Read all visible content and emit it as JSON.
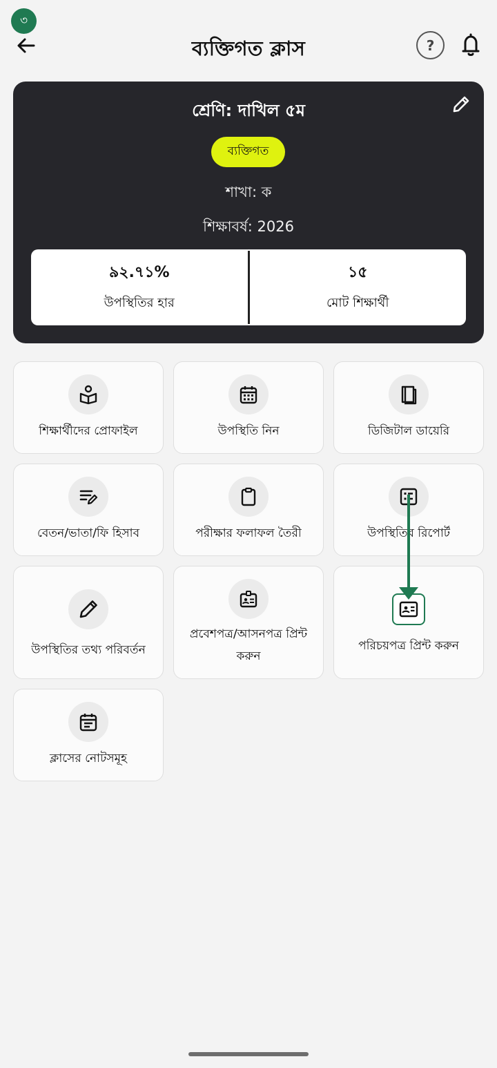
{
  "step_badge": "৩",
  "header": {
    "title": "ব্যক্তিগত ক্লাস",
    "help_label": "?"
  },
  "class_card": {
    "title": "শ্রেণি: দাখিল ৫ম",
    "type_pill": "ব্যক্তিগত",
    "section": "শাখা: ক",
    "academic_year": "শিক্ষাবর্ষ: 2026",
    "stats": [
      {
        "value": "৯২.৭১%",
        "label": "উপস্থিতির হার"
      },
      {
        "value": "১৫",
        "label": "মোট শিক্ষার্থী"
      }
    ]
  },
  "menu": {
    "items": [
      {
        "label": "শিক্ষার্থীদের প্রোফাইল",
        "icon": "student-profile-icon"
      },
      {
        "label": "উপস্থিতি নিন",
        "icon": "calendar-icon"
      },
      {
        "label": "ডিজিটাল ডায়েরি",
        "icon": "book-icon"
      },
      {
        "label": "বেতন/ভাতা/ফি হিসাব",
        "icon": "edit-notes-icon"
      },
      {
        "label": "পরীক্ষার ফলাফল তৈরী",
        "icon": "clipboard-icon"
      },
      {
        "label": "উপস্থিতির রিপোর্ট",
        "icon": "report-list-icon"
      },
      {
        "label": "উপস্থিতির তথ্য পরিবর্তন",
        "icon": "pencil-icon"
      },
      {
        "label": "প্রবেশপত্র/আসনপত্র প্রিন্ট করুন",
        "icon": "badge-icon"
      },
      {
        "label": "পরিচয়পত্র প্রিন্ট করুন",
        "icon": "id-card-icon"
      },
      {
        "label": "ক্লাসের নোটসমূহ",
        "icon": "notes-calendar-icon"
      }
    ]
  },
  "colors": {
    "card_bg": "#26262b",
    "pill_bg": "#dff20f",
    "accent_green": "#1f7a52",
    "page_bg": "#f3f3f3"
  }
}
